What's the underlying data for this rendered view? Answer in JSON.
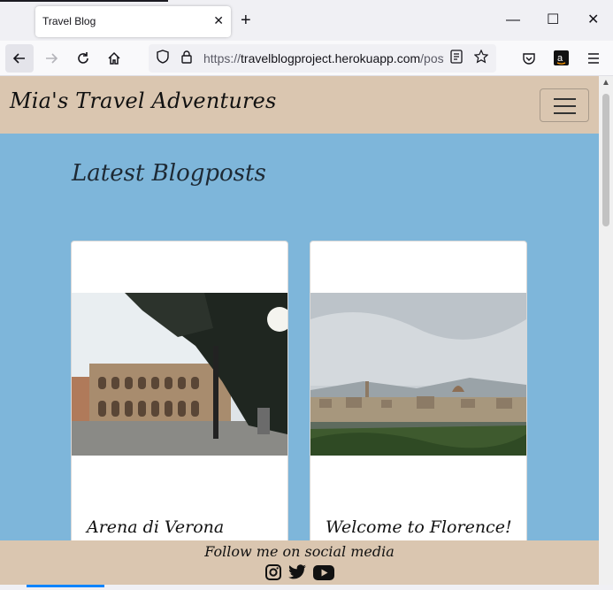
{
  "browser": {
    "tab_title": "Travel Blog",
    "tab_close": "✕",
    "new_tab": "+",
    "url_prefix": "https://",
    "url_host": "travelblogproject.herokuapp.com",
    "url_path": "/posts",
    "window_min": "—",
    "window_max": "☐",
    "window_close": "✕"
  },
  "site": {
    "brand": "Mia's Travel Adventures",
    "section_title": "Latest Blogposts",
    "posts": [
      {
        "title": "Arena di Verona"
      },
      {
        "title": "Welcome to Florence!"
      }
    ],
    "footer_text": "Follow me on social media",
    "social_icons": [
      "instagram-icon",
      "twitter-icon",
      "youtube-icon"
    ]
  },
  "colors": {
    "page_bg": "#7eb6da",
    "header_bg": "#dac6b0"
  }
}
